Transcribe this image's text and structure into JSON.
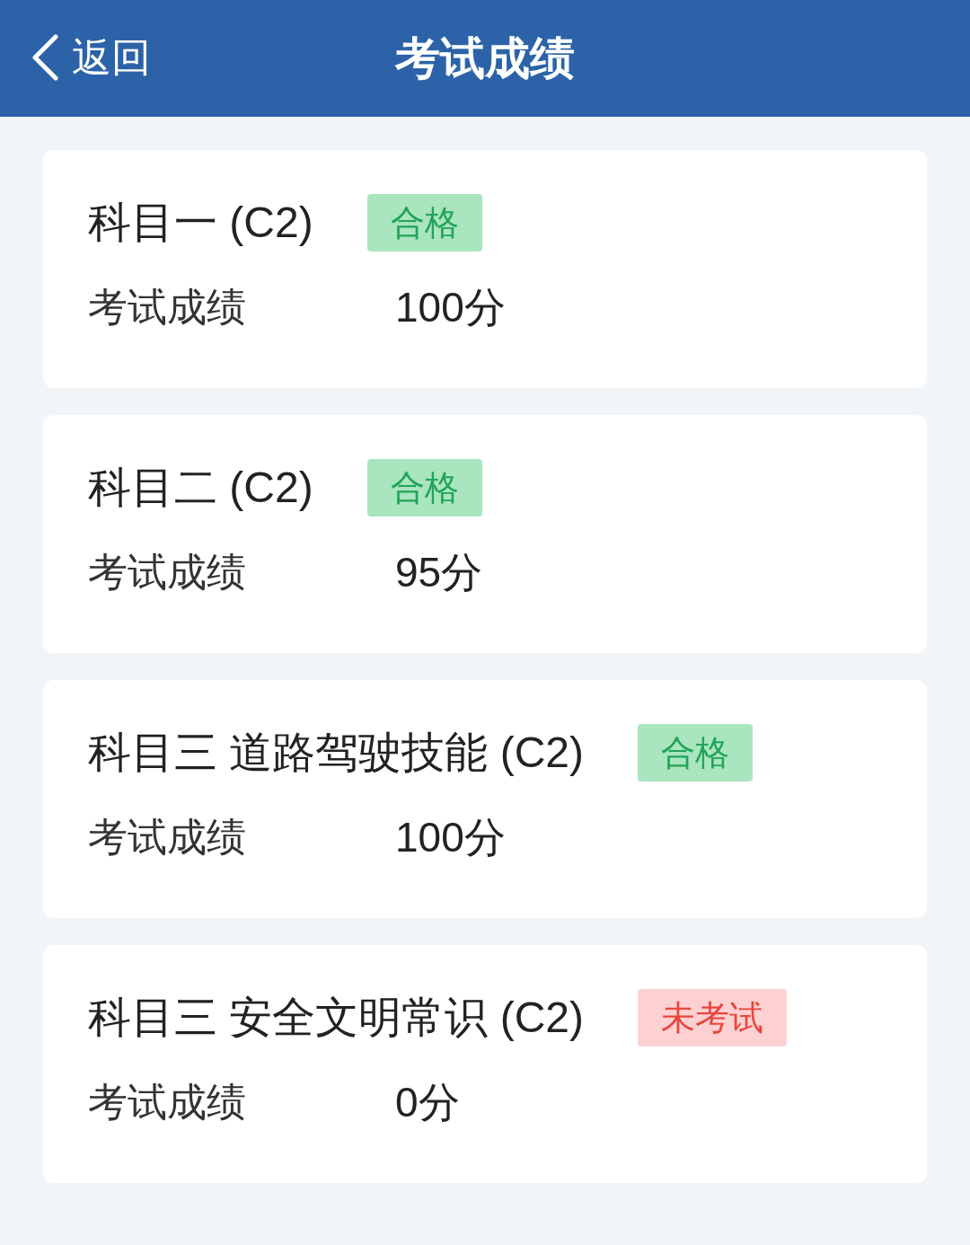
{
  "header": {
    "back": "返回",
    "title": "考试成绩"
  },
  "results": [
    {
      "subject": "科目一 (C2)",
      "badge": {
        "kind": "pass",
        "text": "合格"
      },
      "label": "考试成绩",
      "score": "100分"
    },
    {
      "subject": "科目二 (C2)",
      "badge": {
        "kind": "pass",
        "text": "合格"
      },
      "label": "考试成绩",
      "score": "95分"
    },
    {
      "subject": "科目三 道路驾驶技能 (C2)",
      "badge": {
        "kind": "pass",
        "text": "合格"
      },
      "label": "考试成绩",
      "score": "100分"
    },
    {
      "subject": "科目三 安全文明常识 (C2)",
      "badge": {
        "kind": "untaken",
        "text": "未考试"
      },
      "label": "考试成绩",
      "score": "0分"
    }
  ]
}
